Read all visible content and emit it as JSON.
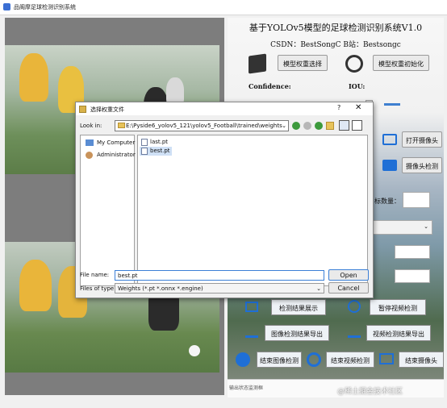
{
  "window": {
    "title": "品阁摩足球检测识别系统"
  },
  "header": {
    "system_title": "基于YOLOv5模型的足球检测识别系统V1.0",
    "csdn_text": "CSDN：BestSongC  B站：Bestsongc"
  },
  "controls": {
    "model_select_label": "模型权重选择",
    "model_init_label": "模型权重初始化",
    "confidence_label": "Confidence:",
    "iou_label": "IOU:",
    "open_camera_label": "打开摄像头",
    "camera_detect_label": "摄像头检测",
    "target_count_label": "目标数量：",
    "show_results_label": "检测结果展示",
    "pause_video_label": "暂停视频检测",
    "export_image_label": "图像检测结果导出",
    "export_video_label": "视频检测结果导出",
    "end_image_label": "结束图像检测",
    "end_video_label": "结束视频检测",
    "end_camera_label": "结束摄像头"
  },
  "status": {
    "label": "输出状态监测框"
  },
  "watermark": "@稀土掘金技术社区",
  "dialog": {
    "title": "选择权重文件",
    "look_in_label": "Look in:",
    "look_in_path": "E:\\Pyside6_yolov5_121\\yolov5_Football\\trained\\weights",
    "places": [
      "My Computer",
      "Administrator"
    ],
    "files": [
      "last.pt",
      "best.pt"
    ],
    "selected_file": "best.pt",
    "file_name_label": "File name:",
    "file_name_value": "best.pt",
    "files_of_type_label": "Files of type:",
    "files_of_type_value": "Weights (*.pt *.onnx *.engine)",
    "open_label": "Open",
    "cancel_label": "Cancel",
    "help_glyph": "?",
    "close_glyph": "✕"
  }
}
